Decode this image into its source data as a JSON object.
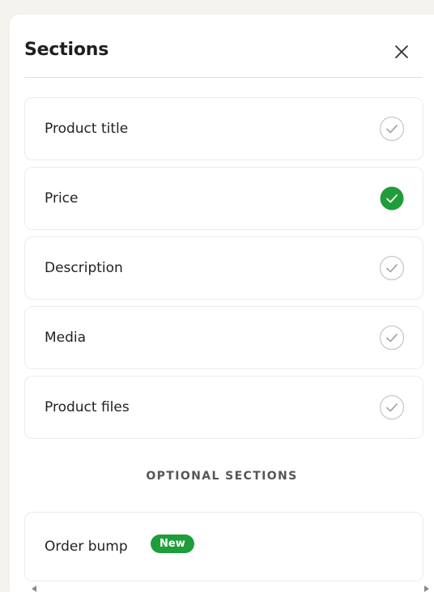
{
  "panel": {
    "title": "Sections",
    "close_icon": "close-icon"
  },
  "sections": [
    {
      "label": "Product title",
      "checked": false
    },
    {
      "label": "Price",
      "checked": true
    },
    {
      "label": "Description",
      "checked": false
    },
    {
      "label": "Media",
      "checked": false
    },
    {
      "label": "Product files",
      "checked": false
    }
  ],
  "optional": {
    "heading": "OPTIONAL SECTIONS",
    "items": [
      {
        "label": "Order bump",
        "badge": "New"
      }
    ]
  },
  "colors": {
    "accent_green": "#1f9d3a",
    "unchecked_gray": "#c9c9c9"
  }
}
